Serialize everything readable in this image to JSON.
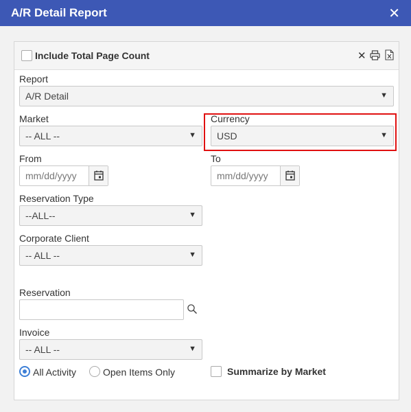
{
  "window": {
    "title": "A/R Detail Report",
    "close_glyph": "✕"
  },
  "header": {
    "include_total_label": "Include Total Page Count",
    "close_glyph": "✕"
  },
  "report": {
    "label": "Report",
    "value": "A/R Detail"
  },
  "market": {
    "label": "Market",
    "value": "-- ALL --"
  },
  "currency": {
    "label": "Currency",
    "value": "USD"
  },
  "from": {
    "label": "From",
    "placeholder": "mm/dd/yyyy"
  },
  "to": {
    "label": "To",
    "placeholder": "mm/dd/yyyy"
  },
  "reservation_type": {
    "label": "Reservation Type",
    "value": "--ALL--"
  },
  "corporate_client": {
    "label": "Corporate Client",
    "value": "-- ALL --"
  },
  "reservation": {
    "label": "Reservation",
    "value": ""
  },
  "invoice": {
    "label": "Invoice",
    "value": "-- ALL --"
  },
  "activity": {
    "options": [
      {
        "label": "All Activity",
        "selected": true
      },
      {
        "label": "Open Items Only",
        "selected": false
      }
    ]
  },
  "summarize": {
    "label": "Summarize by Market",
    "checked": false
  },
  "colors": {
    "titlebar": "#3d58b5",
    "highlight": "#e01010",
    "radio_active": "#3d7fd6"
  },
  "icons": [
    "close-icon",
    "print-icon",
    "excel-icon",
    "calendar-icon",
    "search-icon",
    "caret-down-icon"
  ]
}
